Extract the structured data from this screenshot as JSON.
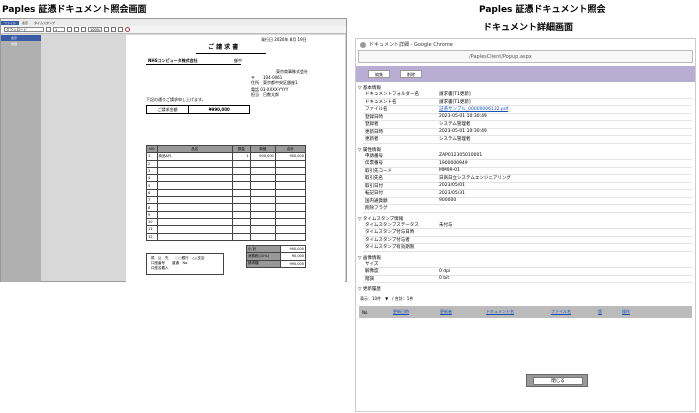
{
  "captions": {
    "left": "Paples 証憑ドキュメント照会画面",
    "right1": "Paples 証憑ドキュメント照会",
    "right2": "ドキュメント詳細画面"
  },
  "viewer": {
    "menu": [
      "ファイル",
      "表示",
      "タイムスタンプ"
    ],
    "zoom": "100%",
    "page": "1",
    "sidebar": [
      "ダウンロード",
      "表示",
      "詳細"
    ]
  },
  "invoice": {
    "date": "発行日 2020年 8月 19日",
    "title": "ご 請 求 書",
    "customer": "NHSコンピュータ株式会社",
    "honorific": "御中",
    "issuer": "東京商事株式会社",
    "postal": "〒　　104-0061",
    "address": "住所　東京都中央区銀座1",
    "phone": "電話 03-XXXX-YYYY",
    "person": "担当　日数太郎",
    "greeting": "下記の通りご請求申し上げます。",
    "total_label": "ご請求金額",
    "total_value": "¥990,000",
    "headers": [
      "NO",
      "品名",
      "数量",
      "単価",
      "合計"
    ],
    "rows": [
      [
        "1",
        "商品A代",
        "1",
        "900,000",
        "900,000"
      ],
      [
        "2",
        "",
        "",
        "",
        ""
      ],
      [
        "3",
        "",
        "",
        "",
        ""
      ],
      [
        "4",
        "",
        "",
        "",
        ""
      ],
      [
        "5",
        "",
        "",
        "",
        ""
      ],
      [
        "6",
        "",
        "",
        "",
        ""
      ],
      [
        "7",
        "",
        "",
        "",
        ""
      ],
      [
        "8",
        "",
        "",
        "",
        ""
      ],
      [
        "9",
        "",
        "",
        "",
        ""
      ],
      [
        "10",
        "",
        "",
        "",
        ""
      ],
      [
        "11",
        "",
        "",
        "",
        ""
      ],
      [
        "12",
        "",
        "",
        "",
        ""
      ]
    ],
    "summary": [
      [
        "小 計",
        "900,000"
      ],
      [
        "消費税(10%)",
        "90,000"
      ],
      [
        "請求額",
        "990,000"
      ]
    ],
    "bank1": "振　込　先　　○○銀行　△△支店",
    "bank2": "口座番号　　普通　No.",
    "bank3": "口座名義人"
  },
  "chrome": {
    "title": "ドキュメント詳細 - Google Chrome",
    "url": "/PaplesClient/Popup.aspx",
    "edit": "編集",
    "delete": "削除",
    "basic_title": "基本情報",
    "basic": [
      [
        "ドキュメントフォルダー名",
        "請求書[T1更新]"
      ],
      [
        "ドキュメント名",
        "請求書[T1更新]"
      ],
      [
        "ファイル名",
        "証憑サンプル_00000006132.pdf"
      ],
      [
        "登録日時",
        "2023-05-01 10:30:49"
      ],
      [
        "登録者",
        "システム管理者"
      ],
      [
        "更新日時",
        "2023-05-01 10:30:49"
      ],
      [
        "更新者",
        "システム管理者"
      ]
    ],
    "attr_title": "属性情報",
    "attr": [
      [
        "申請番号",
        "ZAP012305010001"
      ],
      [
        "伝票番号",
        "1900000949"
      ],
      [
        "取引先コード",
        "MM99-01"
      ],
      [
        "取引先名",
        "日商日立システムエンジニアリング"
      ],
      [
        "取引日付",
        "2023/05/01"
      ],
      [
        "転記日付",
        "2023/05/31"
      ],
      [
        "国内通貨額",
        "900000"
      ],
      [
        "削除フラグ",
        ""
      ]
    ],
    "ts_title": "タイムスタンプ情報",
    "ts": [
      [
        "タイムスタンプステータス",
        "未付与"
      ],
      [
        "タイムスタンプ付与日時",
        ""
      ],
      [
        "タイムスタンプ付与者",
        ""
      ],
      [
        "タイムスタンプ有効期限",
        ""
      ]
    ],
    "img_title": "画像情報",
    "img": [
      [
        "サイズ",
        ""
      ],
      [
        "解像度",
        "0 dpi"
      ],
      [
        "階調",
        "0 bit"
      ]
    ],
    "hist_title": "更新履歴",
    "paging": "表示：10件　▼　/ 合計：1件",
    "hist_cols": [
      "No",
      "更新日時",
      "更新者",
      "ドキュメント名",
      "ファイル名",
      "版",
      "操作"
    ],
    "close": "閉じる"
  }
}
